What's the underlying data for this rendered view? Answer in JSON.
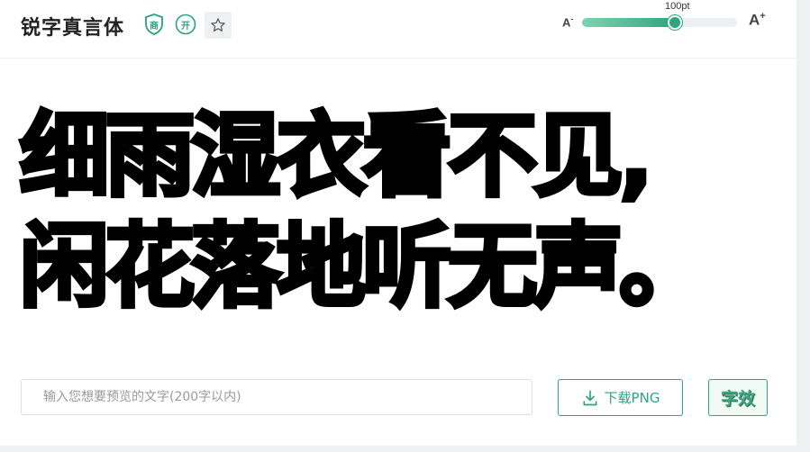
{
  "header": {
    "font_name": "锐字真言体",
    "badge_shang_icon": "shield-shang-icon",
    "badge_shang_text": "商",
    "badge_kai_icon": "circle-kai-icon",
    "badge_kai_text": "开",
    "favorite_icon": "star-icon",
    "size_decrease_label": "A",
    "size_decrease_mark": "-",
    "size_increase_label": "A",
    "size_increase_mark": "+",
    "size_value": "100pt",
    "size_fraction": 0.6
  },
  "preview": {
    "line1": "细雨湿衣看不见,",
    "line2": "闲花落地听无声。"
  },
  "controls": {
    "input_placeholder": "输入您想要预览的文字(200字以内)",
    "input_value": "",
    "download_icon": "download-icon",
    "download_label": "下载PNG",
    "effect_label": "字效"
  },
  "colors": {
    "accent": "#2fa57e",
    "accent_light": "#7cd4b0"
  }
}
